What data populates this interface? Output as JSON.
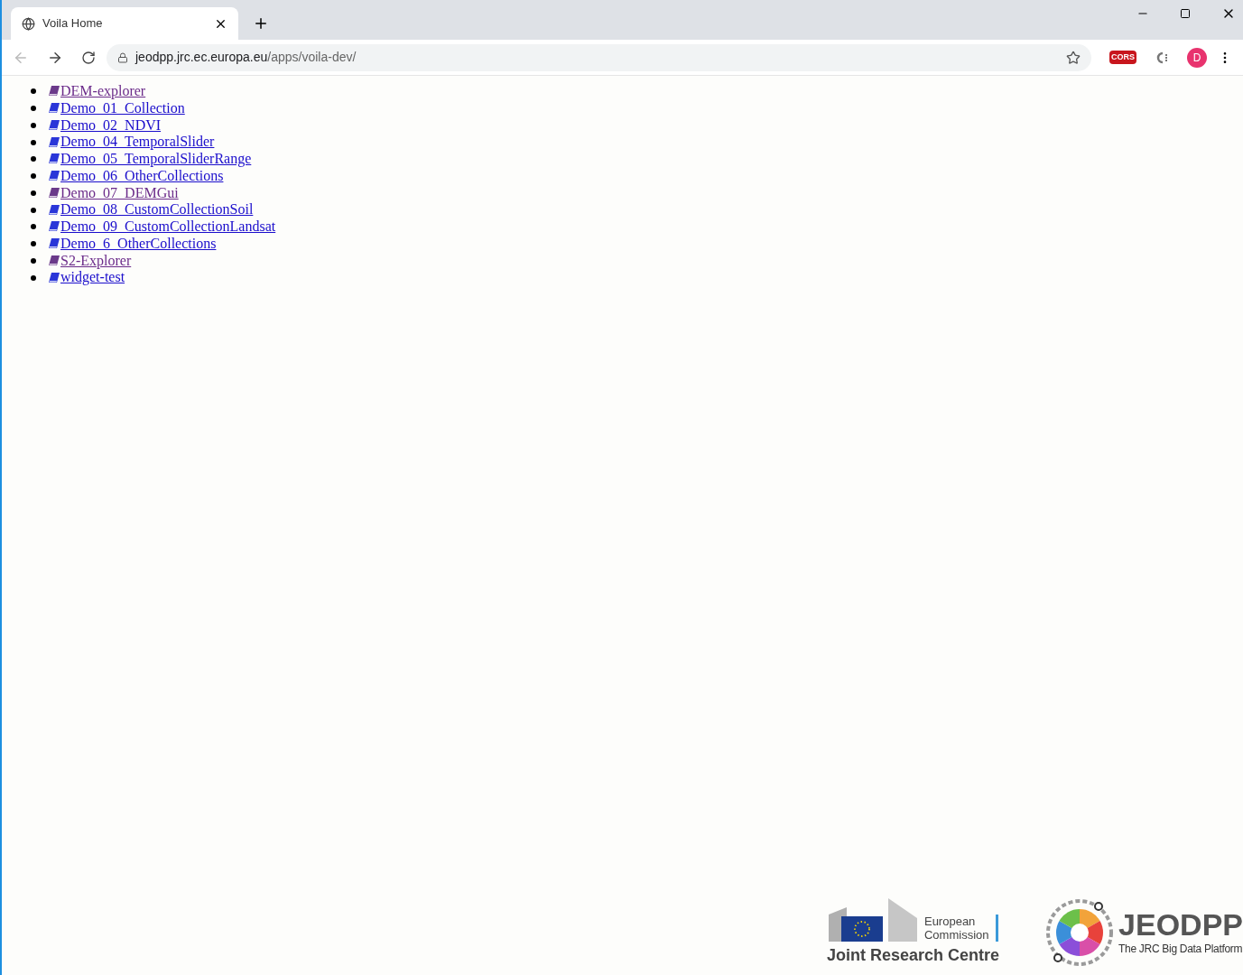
{
  "tab": {
    "title": "Voila Home",
    "selected": true
  },
  "address_bar": {
    "host": "jeodpp.jrc.ec.europa.eu",
    "path": "/apps/voila-dev/"
  },
  "extensions": {
    "cors_label": "CORS",
    "profile_initial": "D"
  },
  "notebooks": [
    {
      "label": "DEM-explorer",
      "visited": true
    },
    {
      "label": "Demo_01_Collection",
      "visited": false
    },
    {
      "label": "Demo_02_NDVI",
      "visited": false
    },
    {
      "label": "Demo_04_TemporalSlider",
      "visited": false
    },
    {
      "label": "Demo_05_TemporalSliderRange",
      "visited": false
    },
    {
      "label": "Demo_06_OtherCollections",
      "visited": false
    },
    {
      "label": "Demo_07_DEMGui",
      "visited": true
    },
    {
      "label": "Demo_08_CustomCollectionSoil",
      "visited": false
    },
    {
      "label": "Demo_09_CustomCollectionLandsat",
      "visited": false
    },
    {
      "label": "Demo_6_OtherCollections",
      "visited": false
    },
    {
      "label": "S2-Explorer",
      "visited": true
    },
    {
      "label": "widget-test",
      "visited": false
    }
  ],
  "footer": {
    "ec_name_line1": "European",
    "ec_name_line2": "Commission",
    "ec_unit": "Joint Research Centre",
    "platform_name": "JEODPP",
    "platform_tagline": "The JRC Big Data Platform"
  }
}
